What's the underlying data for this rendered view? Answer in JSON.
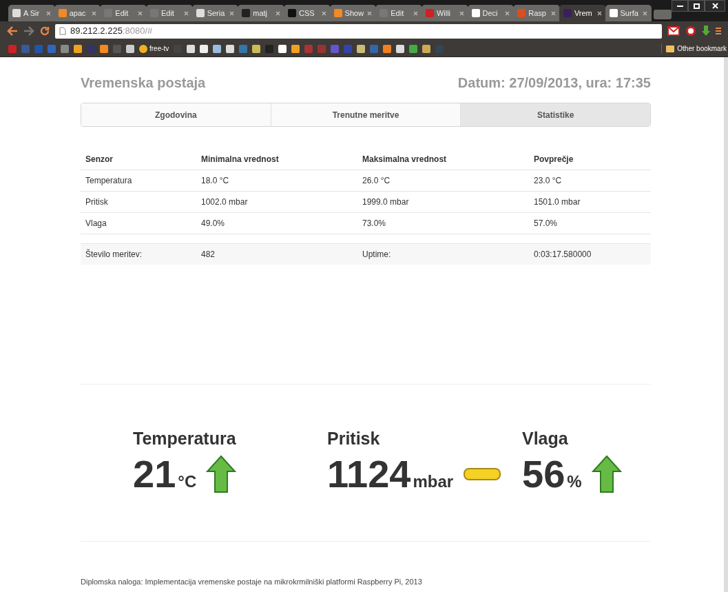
{
  "browser": {
    "tabs": [
      {
        "title": "A Sir",
        "selected": false
      },
      {
        "title": "apac",
        "selected": false
      },
      {
        "title": "Edit",
        "selected": false
      },
      {
        "title": "Edit",
        "selected": false
      },
      {
        "title": "Seria",
        "selected": false
      },
      {
        "title": "matj",
        "selected": false
      },
      {
        "title": "CSS",
        "selected": false
      },
      {
        "title": "Show",
        "selected": false
      },
      {
        "title": "Edit",
        "selected": false
      },
      {
        "title": "Willi",
        "selected": false
      },
      {
        "title": "Deci",
        "selected": false
      },
      {
        "title": "Rasp",
        "selected": false
      },
      {
        "title": "Vrem",
        "selected": true
      },
      {
        "title": "Surfa",
        "selected": false
      }
    ],
    "address": {
      "host": "89.212.2.225",
      "rest": ":8080/#"
    },
    "bookmarks": [
      {
        "label": "free-tv"
      }
    ],
    "other_bookmarks": "Other bookmark"
  },
  "header": {
    "title": "Vremenska postaja",
    "datetime": "Datum: 27/09/2013, ura: 17:35"
  },
  "nav": [
    {
      "label": "Zgodovina",
      "selected": false
    },
    {
      "label": "Trenutne meritve",
      "selected": false
    },
    {
      "label": "Statistike",
      "selected": true
    }
  ],
  "table": {
    "columns": [
      "Senzor",
      "Minimalna vrednost",
      "Maksimalna vrednost",
      "Povprečje"
    ],
    "rows": [
      [
        "Temperatura",
        "18.0 °C",
        "26.0 °C",
        "23.0 °C"
      ],
      [
        "Pritisk",
        "1002.0 mbar",
        "1999.0 mbar",
        "1501.0 mbar"
      ],
      [
        "Vlaga",
        "49.0%",
        "73.0%",
        "57.0%"
      ]
    ],
    "summary": [
      "Število meritev:",
      "482",
      "Uptime:",
      "0:03:17.580000"
    ]
  },
  "readings": [
    {
      "title": "Temperatura",
      "value": "21",
      "unit": "°C",
      "kind": "up"
    },
    {
      "title": "Pritisk",
      "value": "1124",
      "unit": "mbar",
      "kind": "steady"
    },
    {
      "title": "Vlaga",
      "value": "56",
      "unit": "%",
      "kind": "up"
    }
  ],
  "footer": "Diplomska naloga: Implementacija vremenske postaje na mikrokrmilniški platformi Raspberry Pi, 2013"
}
